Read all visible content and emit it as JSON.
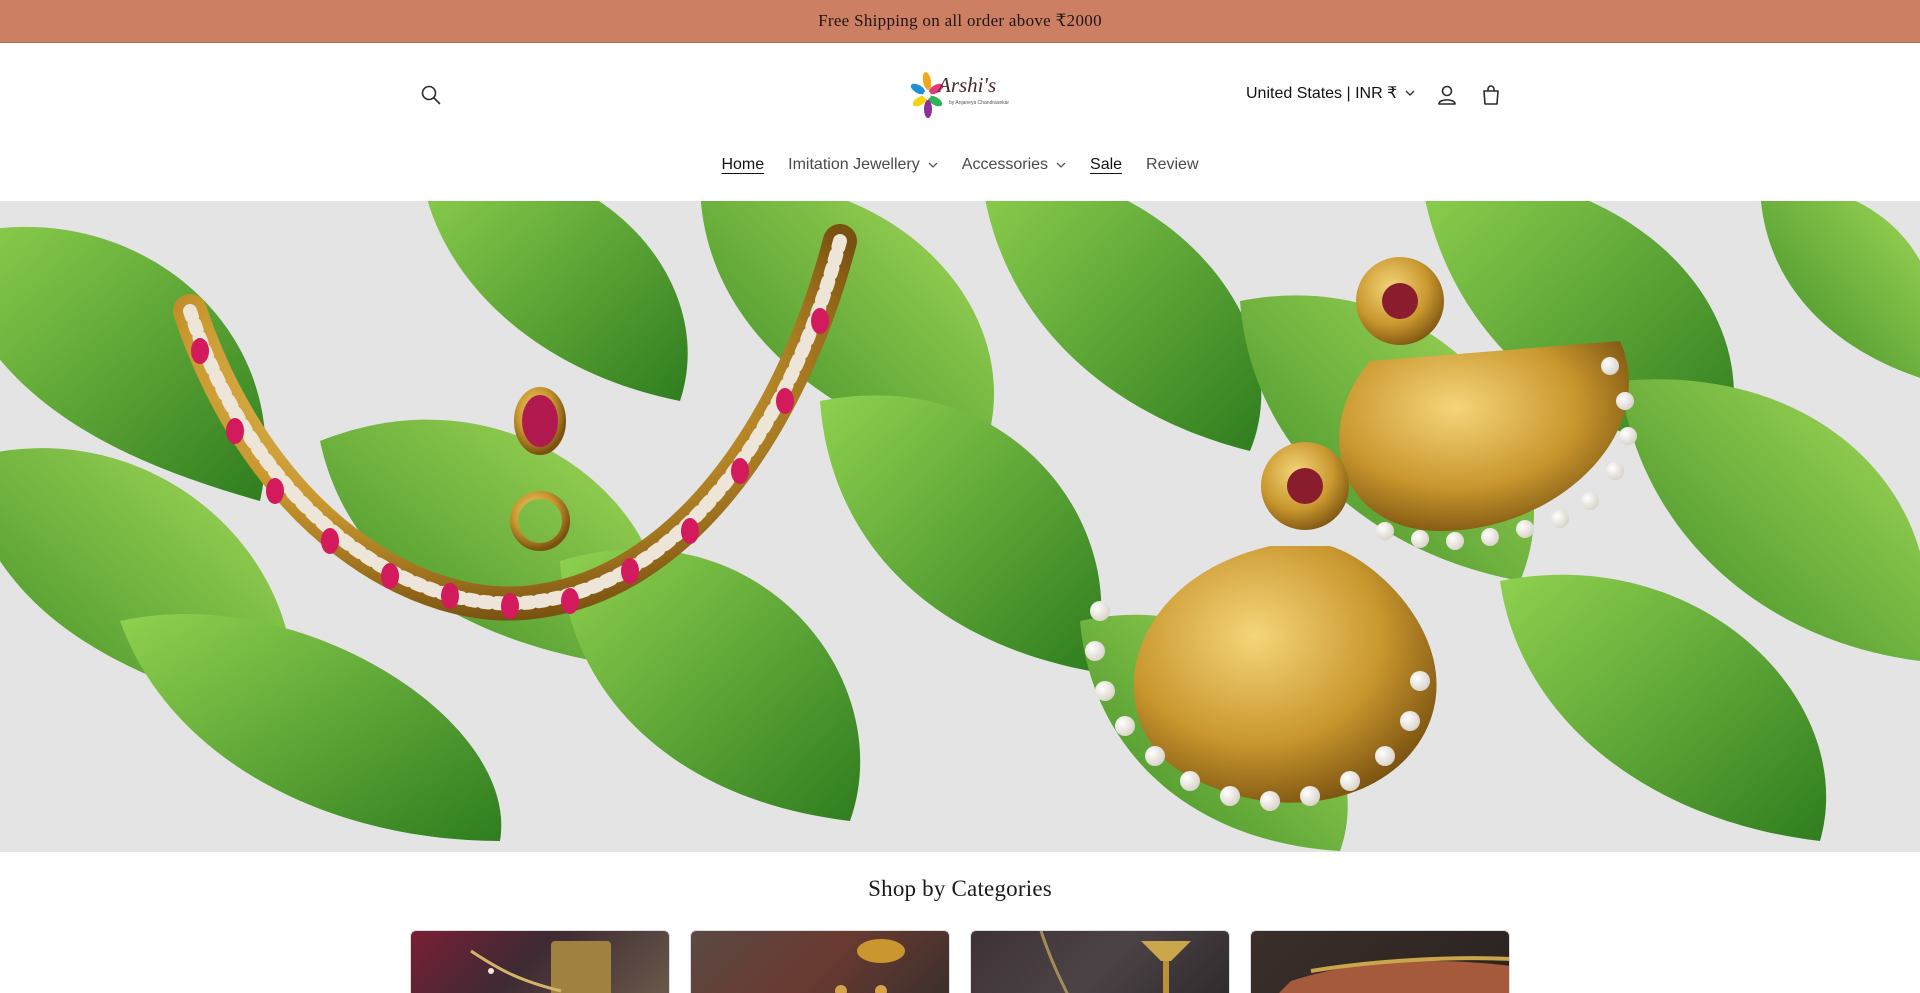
{
  "announcement": {
    "text": "Free Shipping on all order above ₹2000"
  },
  "header": {
    "logo": {
      "name": "Arshi's",
      "tagline": "by Anjaneya Chandrasekar"
    },
    "locale": "United States | INR ₹",
    "icons": [
      "search-icon",
      "account-icon",
      "cart-icon",
      "chevron-down-icon"
    ]
  },
  "nav": {
    "items": [
      {
        "label": "Home",
        "active": true,
        "dropdown": false
      },
      {
        "label": "Imitation Jewellery",
        "active": false,
        "dropdown": true
      },
      {
        "label": "Accessories",
        "active": false,
        "dropdown": true
      },
      {
        "label": "Sale",
        "active": false,
        "dropdown": false
      },
      {
        "label": "Review",
        "active": false,
        "dropdown": false
      }
    ]
  },
  "categories": {
    "title": "Shop by Categories",
    "count": 4
  },
  "colors": {
    "announcement_bg": "#cd7f63",
    "leaf_green": "#5aa636",
    "gold": "#c9972e",
    "ruby": "#d21a5c"
  }
}
